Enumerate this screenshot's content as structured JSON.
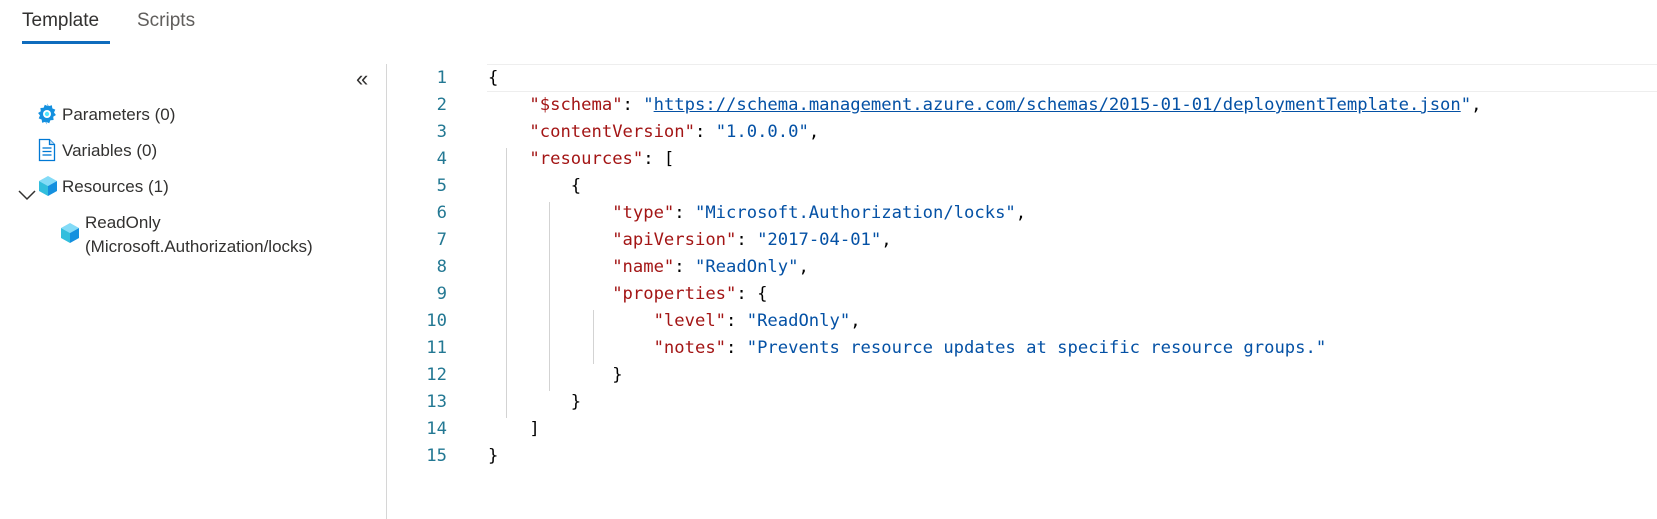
{
  "tabs": [
    {
      "label": "Template",
      "active": true
    },
    {
      "label": "Scripts",
      "active": false
    }
  ],
  "sidebar": {
    "collapse_glyph": "«",
    "items": [
      {
        "label": "Parameters (0)",
        "icon": "gear-icon"
      },
      {
        "label": "Variables (0)",
        "icon": "document-icon"
      },
      {
        "label": "Resources (1)",
        "icon": "cube-icon",
        "expanded": true
      },
      {
        "label": "ReadOnly",
        "sublabel": "(Microsoft.Authorization/locks)",
        "icon": "cube-icon"
      }
    ]
  },
  "editor": {
    "lines": [
      {
        "num": "1",
        "indent": "",
        "parts": [
          {
            "t": "p",
            "v": "{"
          }
        ]
      },
      {
        "num": "2",
        "indent": "    ",
        "parts": [
          {
            "t": "k",
            "v": "\"$schema\""
          },
          {
            "t": "p",
            "v": ": "
          },
          {
            "t": "s",
            "v": "\""
          },
          {
            "t": "l",
            "v": "https://schema.management.azure.com/schemas/2015-01-01/deploymentTemplate.json"
          },
          {
            "t": "s",
            "v": "\""
          },
          {
            "t": "p",
            "v": ","
          }
        ]
      },
      {
        "num": "3",
        "indent": "    ",
        "parts": [
          {
            "t": "k",
            "v": "\"contentVersion\""
          },
          {
            "t": "p",
            "v": ": "
          },
          {
            "t": "s",
            "v": "\"1.0.0.0\""
          },
          {
            "t": "p",
            "v": ","
          }
        ]
      },
      {
        "num": "4",
        "indent": "    ",
        "parts": [
          {
            "t": "k",
            "v": "\"resources\""
          },
          {
            "t": "p",
            "v": ": ["
          }
        ]
      },
      {
        "num": "5",
        "indent": "        ",
        "parts": [
          {
            "t": "p",
            "v": "{"
          }
        ]
      },
      {
        "num": "6",
        "indent": "            ",
        "parts": [
          {
            "t": "k",
            "v": "\"type\""
          },
          {
            "t": "p",
            "v": ": "
          },
          {
            "t": "s",
            "v": "\"Microsoft.Authorization/locks\""
          },
          {
            "t": "p",
            "v": ","
          }
        ]
      },
      {
        "num": "7",
        "indent": "            ",
        "parts": [
          {
            "t": "k",
            "v": "\"apiVersion\""
          },
          {
            "t": "p",
            "v": ": "
          },
          {
            "t": "s",
            "v": "\"2017-04-01\""
          },
          {
            "t": "p",
            "v": ","
          }
        ]
      },
      {
        "num": "8",
        "indent": "            ",
        "parts": [
          {
            "t": "k",
            "v": "\"name\""
          },
          {
            "t": "p",
            "v": ": "
          },
          {
            "t": "s",
            "v": "\"ReadOnly\""
          },
          {
            "t": "p",
            "v": ","
          }
        ]
      },
      {
        "num": "9",
        "indent": "            ",
        "parts": [
          {
            "t": "k",
            "v": "\"properties\""
          },
          {
            "t": "p",
            "v": ": {"
          }
        ]
      },
      {
        "num": "10",
        "indent": "                ",
        "parts": [
          {
            "t": "k",
            "v": "\"level\""
          },
          {
            "t": "p",
            "v": ": "
          },
          {
            "t": "s",
            "v": "\"ReadOnly\""
          },
          {
            "t": "p",
            "v": ","
          }
        ]
      },
      {
        "num": "11",
        "indent": "                ",
        "parts": [
          {
            "t": "k",
            "v": "\"notes\""
          },
          {
            "t": "p",
            "v": ": "
          },
          {
            "t": "s",
            "v": "\"Prevents resource updates at specific resource groups.\""
          }
        ]
      },
      {
        "num": "12",
        "indent": "            ",
        "parts": [
          {
            "t": "p",
            "v": "}"
          }
        ]
      },
      {
        "num": "13",
        "indent": "        ",
        "parts": [
          {
            "t": "p",
            "v": "}"
          }
        ]
      },
      {
        "num": "14",
        "indent": "    ",
        "parts": [
          {
            "t": "p",
            "v": "]"
          }
        ]
      },
      {
        "num": "15",
        "indent": "",
        "parts": [
          {
            "t": "p",
            "v": "}"
          }
        ]
      }
    ]
  },
  "colors": {
    "accent": "#0f6cbd",
    "json_key": "#a31515",
    "json_string": "#0451a5",
    "line_number": "#237893"
  }
}
